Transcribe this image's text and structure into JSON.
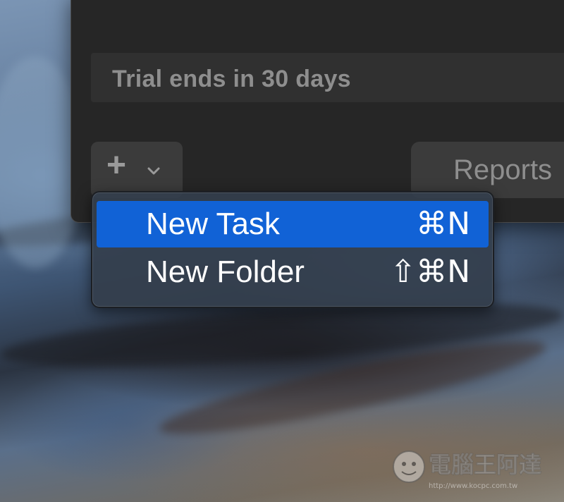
{
  "window": {
    "trial_text": "Trial ends in 30 days",
    "add_button": {
      "icon": "plus-icon",
      "dropdown_icon": "chevron-down-icon"
    },
    "reports_tab": {
      "label": "Reports"
    }
  },
  "menu": {
    "items": [
      {
        "label": "New Task",
        "shortcut": "⌘N",
        "selected": true
      },
      {
        "label": "New Folder",
        "shortcut": "⇧⌘N",
        "selected": false
      }
    ],
    "highlight_color": "#1162d6"
  },
  "watermark": {
    "title": "電腦王阿達",
    "url": "http://www.kocpc.com.tw"
  }
}
